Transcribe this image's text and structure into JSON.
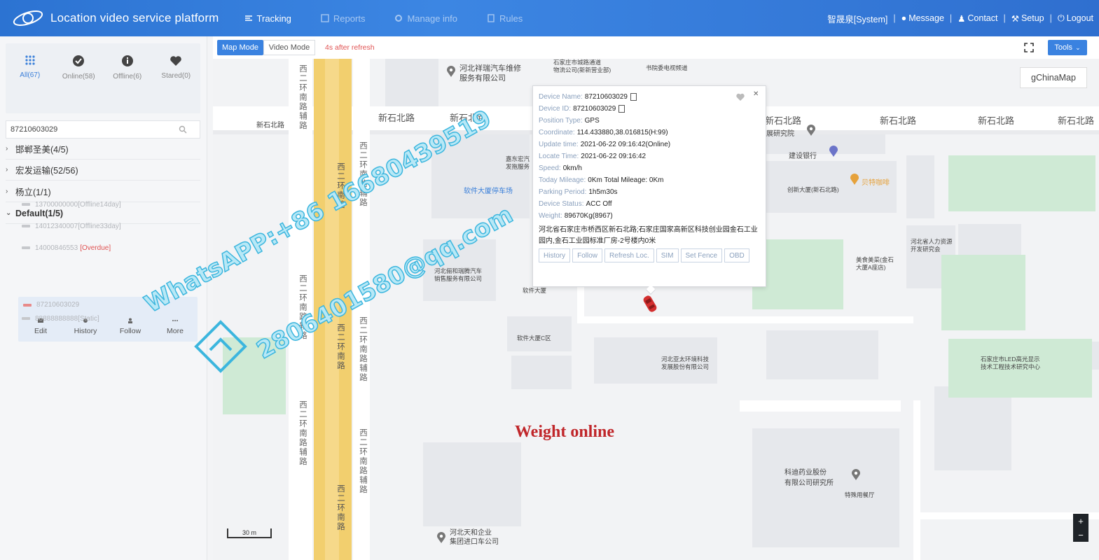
{
  "header": {
    "title": "Location video service platform",
    "nav": [
      {
        "label": "Tracking",
        "icon": "tracking-icon"
      },
      {
        "label": "Reports",
        "icon": "reports-icon"
      },
      {
        "label": "Manage info",
        "icon": "gear-icon"
      },
      {
        "label": "Rules",
        "icon": "rules-icon"
      }
    ],
    "user": "智晟泉[System]",
    "message": "Message",
    "contact": "Contact",
    "setup": "Setup",
    "logout": "Logout",
    "separator": "|"
  },
  "sidebar": {
    "status_tabs": [
      {
        "label": "All(67)",
        "icon": "grid-icon",
        "active": true
      },
      {
        "label": "Online(58)",
        "icon": "check-circle-icon",
        "active": false
      },
      {
        "label": "Offline(6)",
        "icon": "info-circle-icon",
        "active": false
      },
      {
        "label": "Stared(0)",
        "icon": "heart-icon",
        "active": false
      }
    ],
    "search_value": "87210603029",
    "groups": [
      {
        "label": "邯郸圣美(4/5)",
        "expanded": false
      },
      {
        "label": "宏发运输(52/56)",
        "expanded": false
      },
      {
        "label": "杨立(1/1)",
        "expanded": false
      },
      {
        "label": "Default(1/5)",
        "expanded": true
      }
    ],
    "devices": [
      {
        "id": "13700000000",
        "status": "[Offline14day]"
      },
      {
        "id": "14012340007",
        "status": "[Offline33day]"
      },
      {
        "id": "14000846553",
        "status": "[Overdue]"
      },
      {
        "id": "87210603029",
        "status": ""
      },
      {
        "id": "88888888888",
        "status": "[Static]"
      }
    ],
    "card_actions": [
      "Edit",
      "History",
      "Follow",
      "More"
    ]
  },
  "map": {
    "modes": {
      "map": "Map Mode",
      "video": "Video Mode"
    },
    "refresh_note": "4s after refresh",
    "tools": "Tools",
    "gchina": "gChinaMap",
    "scale": "30 m",
    "overlay_text": "Weight online",
    "labels": {
      "road_xinshi": "新石北路",
      "west_ring_main": "西二环南路",
      "west_ring_aux": "西二环南路辅路",
      "poi_repair": "河北祥瑞汽车维修\n服务有限公司",
      "poi_logistics": "石家庄市城路通道\n物流公司(新新营业部)",
      "poi_tv": "书院委电视频道",
      "poi_research": "展研究院",
      "poi_bank": "建设银行",
      "poi_coffee": "贝特咖啡",
      "poi_chuangxin": "创新大厦(新石北路)",
      "poi_parking": "软件大厦停车场",
      "poi_chunmei": "嘉东宏汽\n发拖服务",
      "poi_hr": "河北省人力资源\n开发研究会",
      "poi_meiyu": "美食美菜(金石\n大厦A座店)",
      "poi_car": "河北俪和瑞腾汽车\n销售服务有限公司",
      "poi_software": "软件大厦",
      "poi_software_c": "软件大厦C区",
      "poi_env": "河北亚太环境科技\n发展股份有限公司",
      "poi_led": "石家庄市LED高光显示\n技术工程技术研究中心",
      "poi_pharma": "科迪药业股份\n有限公司研究所",
      "poi_canteen": "特殊用餐厅",
      "poi_tianhe": "河北天和企业\n集团进口车公司"
    }
  },
  "popup": {
    "device_name_key": "Device Name:",
    "device_name": "87210603029",
    "device_id_key": "Device ID:",
    "device_id": "87210603029",
    "position_type_key": "Position Type:",
    "position_type": "GPS",
    "coordinate_key": "Coordinate:",
    "coordinate": "114.433880,38.016815(H:99)",
    "update_time_key": "Update time:",
    "update_time": "2021-06-22 09:16:42(Online)",
    "locate_time_key": "Locate Time:",
    "locate_time": "2021-06-22 09:16:42",
    "speed_key": "Speed:",
    "speed": "0km/h",
    "today_mileage_key": "Today Mileage:",
    "today_mileage": "0Km Total Mileage: 0Km",
    "parking_period_key": "Parking Period:",
    "parking_period": "1h5m30s",
    "device_status_key": "Device Status:",
    "device_status": "ACC Off",
    "weight_key": "Weight:",
    "weight": "89670Kg(8967)",
    "address": "河北省石家庄市桥西区新石北路;石家庄国家高新区科技创业园金石工业园内,金石工业园标准厂房-2号楼内0米",
    "buttons": [
      "History",
      "Follow",
      "Refresh Loc.",
      "SIM",
      "Set Fence",
      "OBD"
    ]
  },
  "watermark": {
    "line1": "WhatsAPP:+86 16680439519",
    "line2": "2806401580@qq.com"
  },
  "colors": {
    "header": "#2f74d6",
    "accent": "#3a82e0",
    "overdue": "#e05252",
    "weight_text": "#c0262a"
  }
}
